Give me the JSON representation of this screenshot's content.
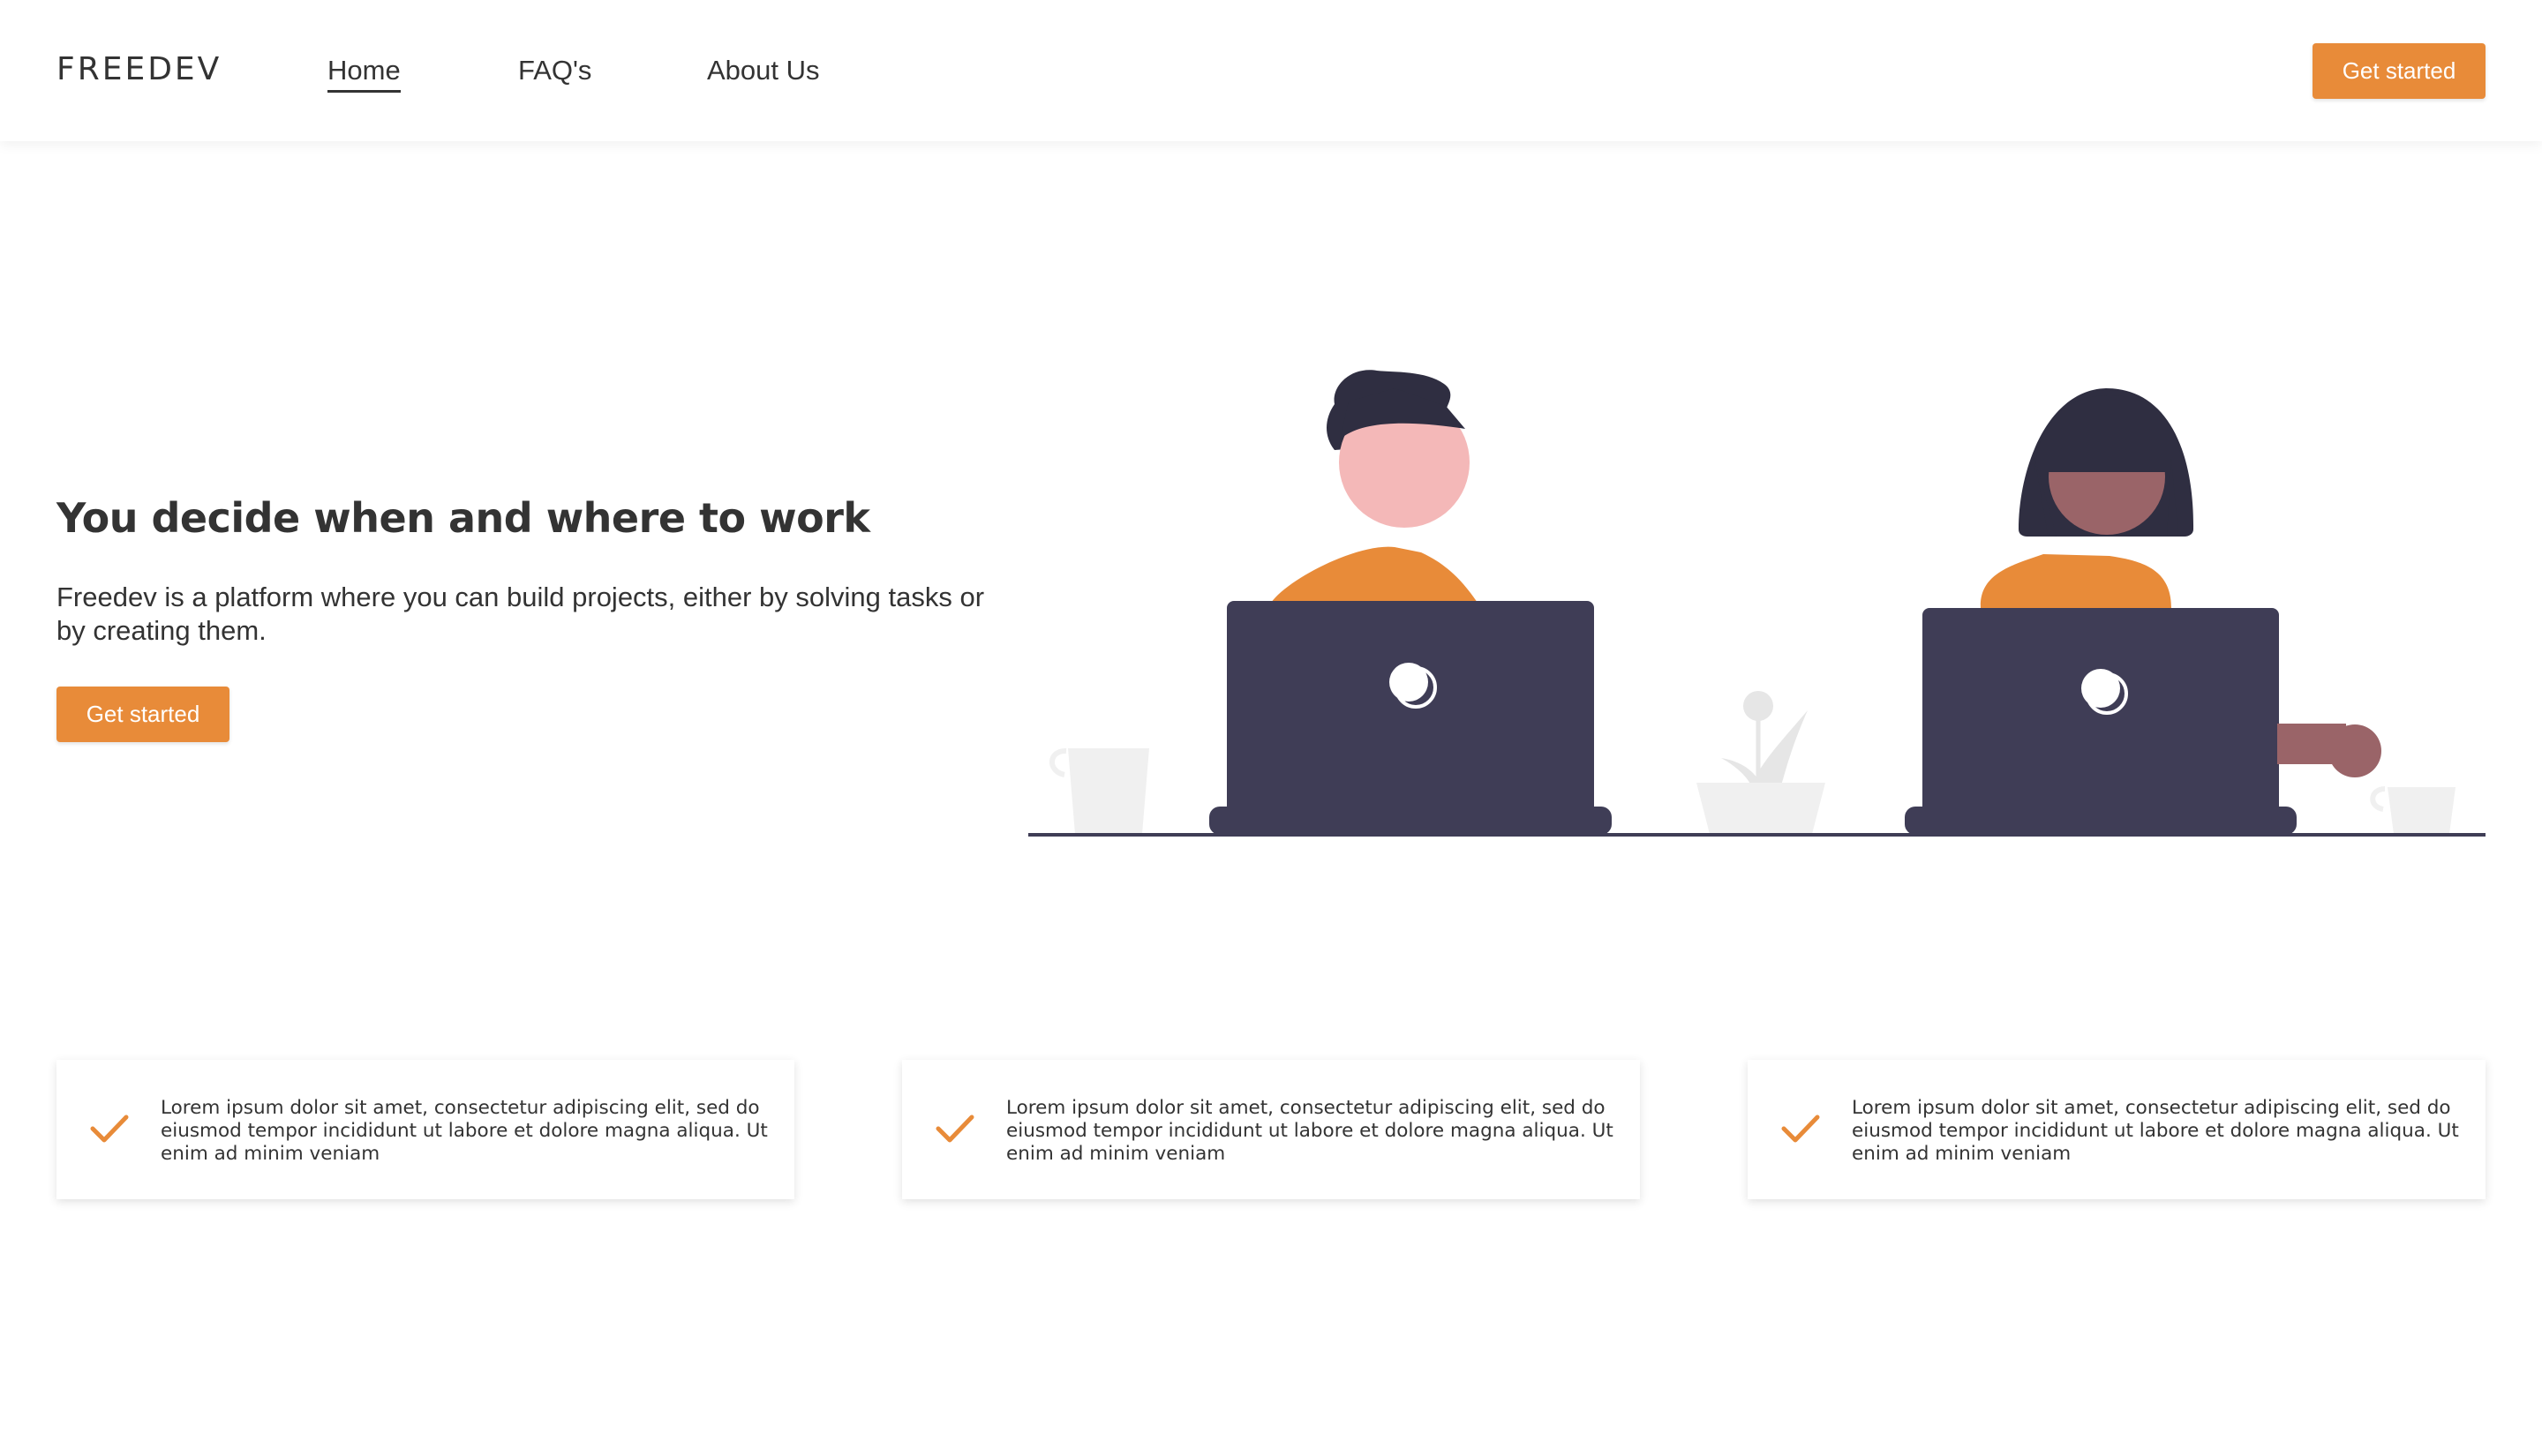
{
  "header": {
    "logo": "FREEDEV",
    "nav": [
      {
        "label": "Home",
        "active": true
      },
      {
        "label": "FAQ's",
        "active": false
      },
      {
        "label": "About Us",
        "active": false
      }
    ],
    "cta_label": "Get started"
  },
  "hero": {
    "title": "You decide when and where to work",
    "description": "Freedev is a platform where you can build projects, either by solving tasks or by creating them.",
    "cta_label": "Get started"
  },
  "features": [
    {
      "text": "Lorem ipsum dolor sit amet, consectetur adipiscing elit, sed do eiusmod tempor incididunt ut labore et dolore magna aliqua. Ut enim ad minim veniam",
      "icon": "check-icon"
    },
    {
      "text": "Lorem ipsum dolor sit amet, consectetur adipiscing elit, sed do eiusmod tempor incididunt ut labore et dolore magna aliqua. Ut enim ad minim veniam",
      "icon": "check-icon"
    },
    {
      "text": "Lorem ipsum dolor sit amet, consectetur adipiscing elit, sed do eiusmod tempor incididunt ut labore et dolore magna aliqua. Ut enim ad minim veniam",
      "icon": "check-icon"
    }
  ],
  "colors": {
    "accent": "#e88b39",
    "text": "#333333",
    "laptop": "#3f3d56",
    "hair": "#2f2e41",
    "skin_light": "#f4b8b8",
    "skin_dark": "#9a6468",
    "decor": "#f0f0f0"
  }
}
